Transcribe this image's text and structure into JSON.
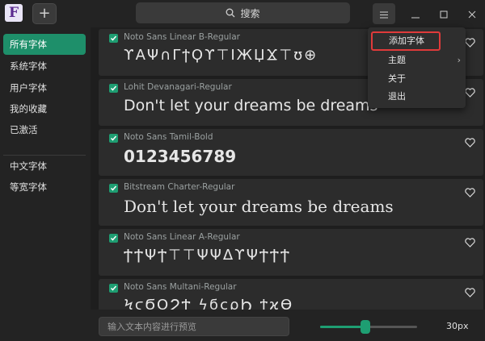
{
  "app": {
    "logo_letter": "F"
  },
  "header": {
    "search_label": "搜索"
  },
  "sidebar": {
    "items": [
      {
        "label": "所有字体",
        "active": true
      },
      {
        "label": "系统字体"
      },
      {
        "label": "用户字体"
      },
      {
        "label": "我的收藏"
      },
      {
        "label": "已激活"
      }
    ],
    "groups": [
      {
        "label": "中文字体"
      },
      {
        "label": "等宽字体"
      }
    ]
  },
  "fonts": [
    {
      "name": "Noto Sans Linear B-Regular",
      "preview": "ϒΑΨ∩ΓϯϘϒ⊤ΙЖЏϪ⊤ʊ⊕",
      "checked": true
    },
    {
      "name": "Lohit Devanagari-Regular",
      "preview": "Don't let your dreams be dreams",
      "checked": true
    },
    {
      "name": "Noto Sans Tamil-Bold",
      "preview": "0123456789",
      "checked": true
    },
    {
      "name": "Bitstream Charter-Regular",
      "preview": "Don't let your dreams be dreams",
      "checked": true
    },
    {
      "name": "Noto Sans Linear A-Regular",
      "preview": "ϮϮΨϮ⊤⊤ΨΨΔϒΨϮϮϮ",
      "checked": true
    },
    {
      "name": "Noto Sans Multani-Regular",
      "preview": "ϞϛϬϘϨϮ ϟϭϲϱϦ ϯϰϴ",
      "checked": true
    }
  ],
  "bottom": {
    "preview_placeholder": "输入文本内容进行预览",
    "size_label": "30px",
    "slider_fraction": 0.47
  },
  "menu": {
    "items": [
      {
        "label": "添加字体"
      },
      {
        "label": "主题",
        "submenu_arrow": "›"
      },
      {
        "label": "关于"
      },
      {
        "label": "退出"
      }
    ]
  },
  "colors": {
    "accent": "#1e9e72",
    "highlight_border": "#e03a3a"
  }
}
